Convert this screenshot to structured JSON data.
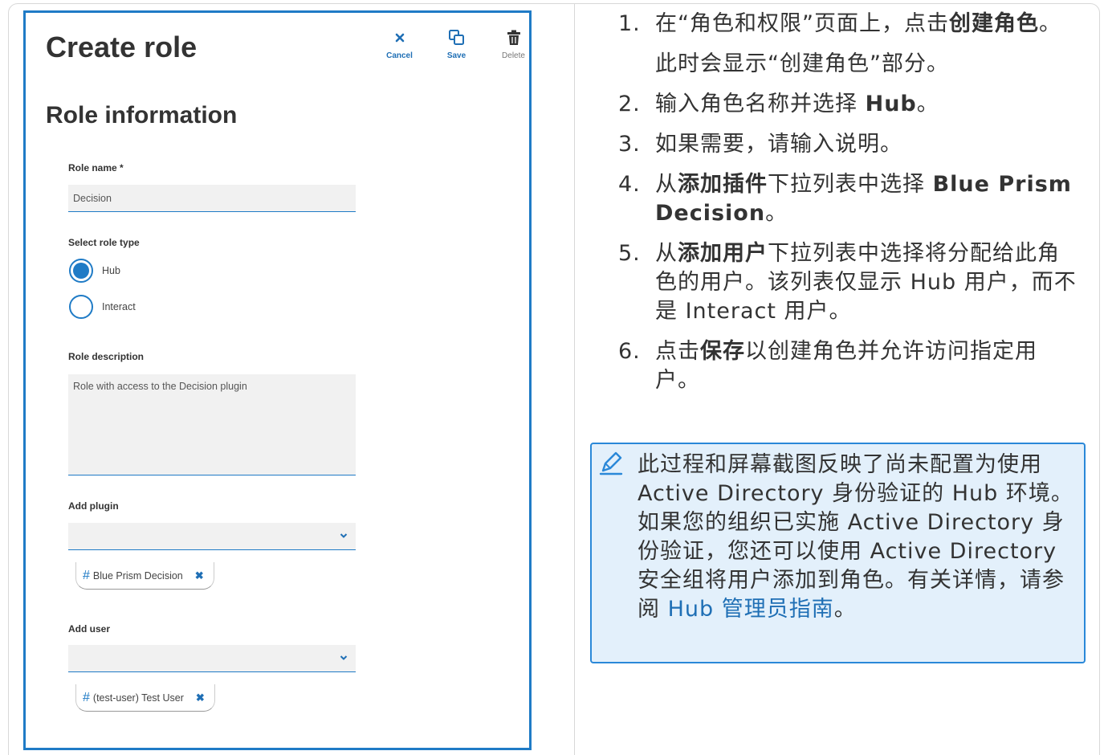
{
  "panel": {
    "title": "Create role",
    "toolbar": {
      "cancel_label": "Cancel",
      "save_label": "Save",
      "delete_label": "Delete"
    },
    "section_title": "Role information",
    "role_name_label": "Role name *",
    "role_name_value": "Decision",
    "role_type_label": "Select role type",
    "role_type_options": [
      "Hub",
      "Interact"
    ],
    "role_type_selected": "Hub",
    "description_label": "Role description",
    "description_value": "Role with access to the Decision plugin",
    "add_plugin_label": "Add plugin",
    "plugin_chip": "Blue Prism Decision",
    "add_user_label": "Add user",
    "user_chip": "(test-user) Test User"
  },
  "instructions": {
    "steps": [
      {
        "num": "1.",
        "pre": "在“角色和权限”页面上，点击",
        "bold": "创建角色",
        "post": "。"
      },
      {
        "num": "2.",
        "pre": "输入角色名称并选择 ",
        "bold": "Hub",
        "post": "。"
      },
      {
        "num": "3.",
        "pre": "如果需要，请输入说明。",
        "bold": "",
        "post": ""
      },
      {
        "num": "4.",
        "pre": "从",
        "bold": "添加插件",
        "mid": "下拉列表中选择 ",
        "bold2": "Blue Prism Decision",
        "post": "。"
      },
      {
        "num": "5.",
        "pre": "从",
        "bold": "添加用户",
        "post": "下拉列表中选择将分配给此角色的用户。该列表仅显示 Hub 用户，而不是 Interact 用户。"
      },
      {
        "num": "6.",
        "pre": "点击",
        "bold": "保存",
        "post": "以创建角色并允许访问指定用户。"
      }
    ],
    "step1_subtext": "此时会显示“创建角色”部分。"
  },
  "note": {
    "text": "此过程和屏幕截图反映了尚未配置为使用 Active Directory 身份验证的 Hub 环境。如果您的组织已实施 Active Directory 身份验证，您还可以使用 Active Directory 安全组将用户添加到角色。有关详情，请参阅 ",
    "link_text": "Hub 管理员指南",
    "suffix": "。"
  },
  "colors": {
    "accent": "#1f7bc6",
    "note_bg": "#e3f0fb",
    "note_border": "#2a88d8"
  }
}
